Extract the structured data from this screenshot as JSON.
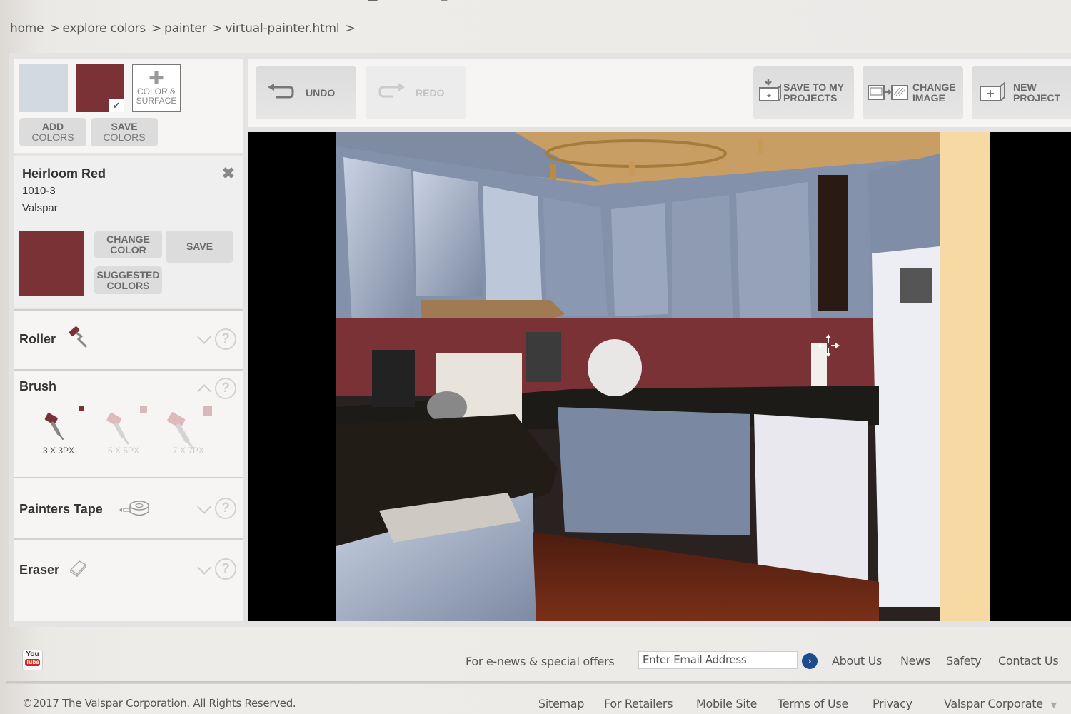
{
  "breadcrumb": {
    "items": [
      "home",
      "explore colors",
      "painter",
      "virtual-painter.html"
    ],
    "separator": ">"
  },
  "palette": {
    "swatches": [
      {
        "name": "light-blue-gray",
        "color": "#d2d9e1",
        "selected": false
      },
      {
        "name": "heirloom-red",
        "color": "#7b3237",
        "selected": true
      }
    ],
    "check_glyph": "✔",
    "add_surface": {
      "icon": "plus-icon",
      "line1": "COLOR &",
      "line2": "SURFACE"
    },
    "add_colors": {
      "bold": "ADD",
      "rest": "COLORS"
    },
    "save_colors": {
      "bold": "SAVE",
      "rest": "COLORS"
    }
  },
  "selected_color": {
    "name": "Heirloom Red",
    "code": "1010-3",
    "brand": "Valspar",
    "hex": "#7b3237",
    "close_glyph": "✖",
    "change_color": {
      "line1": "CHANGE",
      "line2": "COLOR"
    },
    "suggested_colors": {
      "line1": "SUGGESTED",
      "line2": "COLORS"
    },
    "save_label": "SAVE"
  },
  "tools": {
    "roller": {
      "label": "Roller",
      "icon": "roller-icon",
      "expanded": false
    },
    "brush": {
      "label": "Brush",
      "icon": "brush-icon",
      "expanded": true,
      "sizes": [
        {
          "label": "3 X 3PX",
          "active": true
        },
        {
          "label": "5 X 5PX",
          "active": false
        },
        {
          "label": "7 X 7PX",
          "active": false
        }
      ]
    },
    "tape": {
      "label": "Painters Tape",
      "icon": "tape-icon",
      "expanded": false
    },
    "eraser": {
      "label": "Eraser",
      "icon": "eraser-icon",
      "expanded": false
    },
    "help_glyph": "?"
  },
  "toolbar": {
    "undo": {
      "label": "UNDO",
      "enabled": true
    },
    "redo": {
      "label": "REDO",
      "enabled": false
    },
    "save_project": {
      "line1": "SAVE TO MY",
      "line2": "PROJECTS"
    },
    "change_image": {
      "line1": "CHANGE",
      "line2": "IMAGE"
    },
    "new_project": {
      "line1": "NEW",
      "line2": "PROJECT"
    }
  },
  "canvas": {
    "description": "Kitchen photo with cabinets painted blue-gray and backsplash wall painted Heirloom Red",
    "wall_color": "#7b3237",
    "cabinet_color": "#8e9bb3"
  },
  "footer": {
    "youtube": {
      "line1": "You",
      "line2": "Tube"
    },
    "newsletter_label": "For e-news & special offers",
    "email_placeholder": "Enter Email Address",
    "submit_glyph": "›",
    "links_top": [
      "About Us",
      "News",
      "Safety",
      "Contact Us"
    ],
    "copyright": "©2017 The Valspar Corporation. All Rights Reserved.",
    "links_bottom": [
      "Sitemap",
      "For Retailers",
      "Mobile Site",
      "Terms of Use",
      "Privacy"
    ],
    "corporate_dropdown": "Valspar Corporate",
    "dropdown_glyph": "▼"
  }
}
